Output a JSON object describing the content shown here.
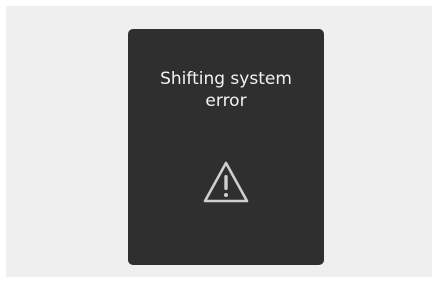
{
  "colors": {
    "background": "#efefef",
    "panel": "#2f2f2f",
    "text": "#f2f2f2",
    "icon": "#cfcfcf"
  },
  "dialog": {
    "message_line1": "Shifting system",
    "message_line2": "error",
    "icon": "warning-triangle-icon"
  }
}
